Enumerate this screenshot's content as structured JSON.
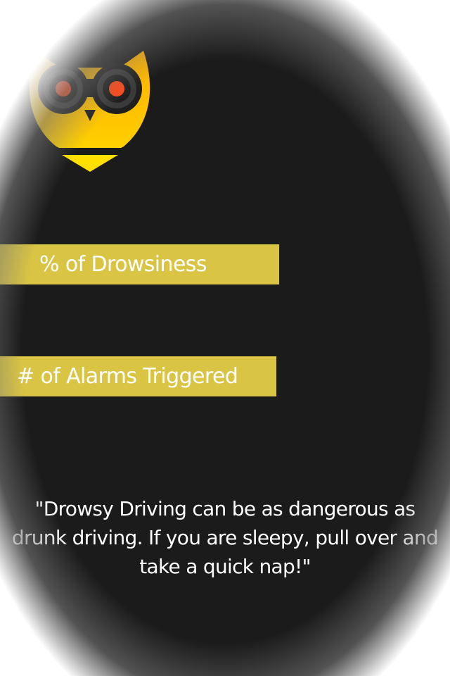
{
  "app": {
    "logo_icon": "owl-icon"
  },
  "theme": {
    "background": "#1b1b1b",
    "accent": "#d9c443",
    "owl_yellow": "#ffc000",
    "owl_eye": "#ff4a1a"
  },
  "stats": {
    "drowsiness_label": "% of Drowsiness",
    "alarms_label": "# of Alarms Triggered"
  },
  "quote": {
    "text": "\"Drowsy Driving can be as dangerous as drunk driving. If you are sleepy, pull over and take a quick nap!\""
  }
}
